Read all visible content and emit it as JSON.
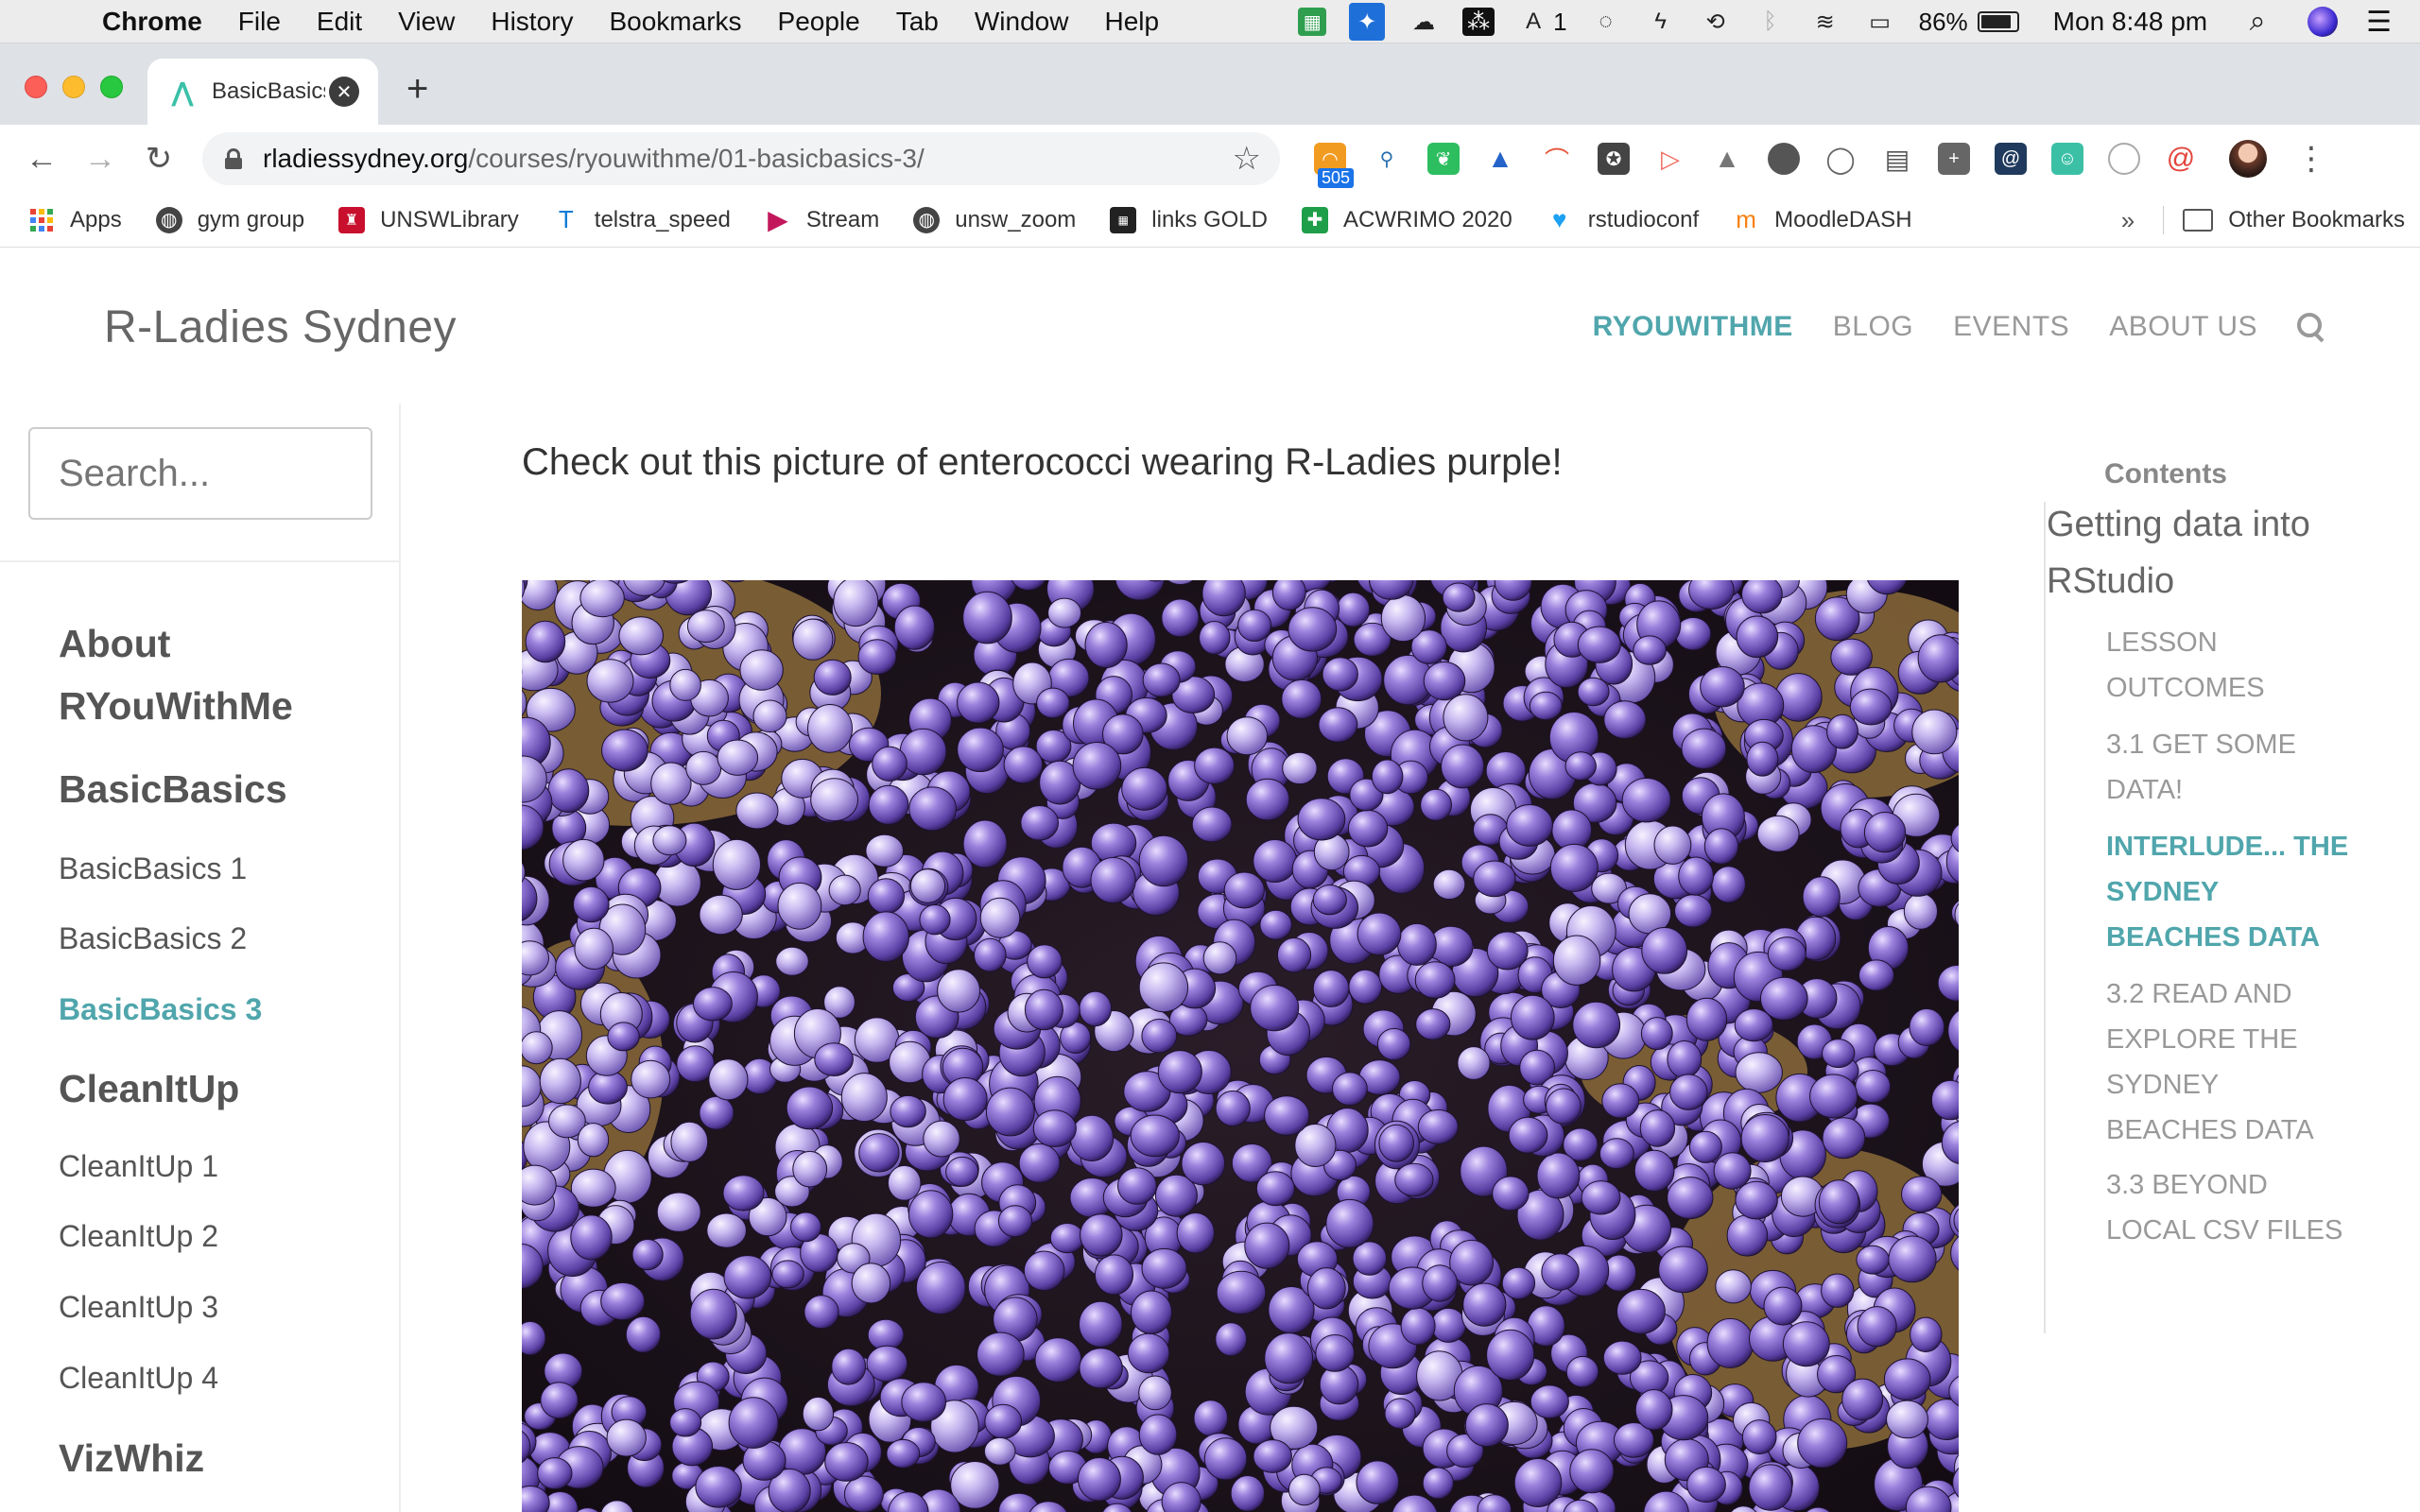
{
  "menubar": {
    "app": "Chrome",
    "items": [
      "File",
      "Edit",
      "View",
      "History",
      "Bookmarks",
      "People",
      "Tab",
      "Window",
      "Help"
    ],
    "tray_badge": "1",
    "battery": "86%",
    "battery_level": 0.86,
    "clock": "Mon 8:48 pm"
  },
  "browser": {
    "tab_title": "BasicBasics",
    "url_host": "rladiessydney.org",
    "url_path": "/courses/ryouwithme/01-basicbasics-3/",
    "rss_badge": "505",
    "bookmarks": [
      "Apps",
      "gym group",
      "UNSWLibrary",
      "telstra_speed",
      "Stream",
      "unsw_zoom",
      "links GOLD",
      "ACWRIMO 2020",
      "rstudioconf",
      "MoodleDASH"
    ],
    "overflow": "»",
    "other_bookmarks": "Other Bookmarks"
  },
  "site": {
    "title": "R-Ladies Sydney",
    "nav": [
      "RYOUWITHME",
      "BLOG",
      "EVENTS",
      "ABOUT US"
    ],
    "active_nav": "RYOUWITHME",
    "accent": "#50a6ac"
  },
  "sidebar": {
    "search_placeholder": "Search...",
    "sections": [
      {
        "heading": "About RYouWithMe",
        "links": []
      },
      {
        "heading": "BasicBasics",
        "links": [
          "BasicBasics 1",
          "BasicBasics 2",
          "BasicBasics 3"
        ]
      },
      {
        "heading": "CleanItUp",
        "links": [
          "CleanItUp 1",
          "CleanItUp 2",
          "CleanItUp 3",
          "CleanItUp 4"
        ]
      },
      {
        "heading": "VizWhiz",
        "links": []
      }
    ],
    "active_link": "BasicBasics 3"
  },
  "content": {
    "intro": "Check out this picture of enterococci wearing R-Ladies purple!",
    "image_subject": "purple-enterococci-micrograph"
  },
  "toc": {
    "title": "Contents",
    "main": "Getting data into RStudio",
    "items": [
      {
        "label": "LESSON OUTCOMES",
        "active": false
      },
      {
        "label": "3.1 GET SOME DATA!",
        "active": false
      },
      {
        "label": "INTERLUDE... THE SYDNEY BEACHES DATA",
        "active": true
      },
      {
        "label": "3.2 READ AND EXPLORE THE SYDNEY BEACHES DATA",
        "active": false
      },
      {
        "label": "3.3 BEYOND LOCAL CSV FILES",
        "active": false
      }
    ]
  }
}
